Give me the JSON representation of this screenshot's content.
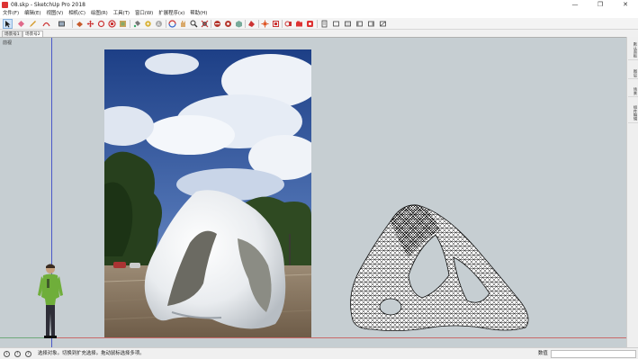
{
  "window": {
    "title": "08.skp - SketchUp Pro 2018",
    "controls": [
      "—",
      "❐",
      "✕"
    ]
  },
  "menu": {
    "items": [
      "文件(F)",
      "编辑(E)",
      "视图(V)",
      "相机(C)",
      "绘图(R)",
      "工具(T)",
      "窗口(W)",
      "扩展程序(x)",
      "帮助(H)"
    ]
  },
  "toolbar": {
    "tools": [
      "select-tool",
      "eraser-tool",
      "pencil-tool",
      "arc-tool",
      "rectangle-tool",
      "push-pull-tool",
      "move-tool",
      "rotate-tool",
      "scale-tool",
      "offset-tool",
      "paint-bucket-tool",
      "tape-measure-tool",
      "text-tool",
      "orbit-tool",
      "pan-tool",
      "zoom-tool",
      "zoom-extents-tool",
      "section-plane-tool",
      "warehouse-tool",
      "extension-warehouse-tool",
      "style-tool",
      "layer-tool",
      "shadow-tool",
      "scenes-tool",
      "outliner-tool",
      "component-tool",
      "materials-tool",
      "iso-view",
      "top-view",
      "front-view",
      "right-view",
      "back-view",
      "left-view"
    ]
  },
  "scenes": {
    "tabs": [
      "场景号1",
      "场景号2"
    ],
    "active": 1
  },
  "viewport": {
    "label": "前视",
    "colors": {
      "background": "#c6ced2",
      "axis_blue": "#4a59c9",
      "axis_red": "#c96a6a",
      "axis_green": "#4a9a56"
    }
  },
  "tray": {
    "tabs": [
      "默认面板",
      "图层",
      "场景",
      "组件编辑"
    ]
  },
  "status": {
    "icons": [
      "geo-location-icon",
      "info-icon",
      "help-icon"
    ],
    "text": "选择对象。切换到扩充选择。拖动鼠标选择多项。",
    "measure_label": "数值",
    "measure_value": ""
  }
}
